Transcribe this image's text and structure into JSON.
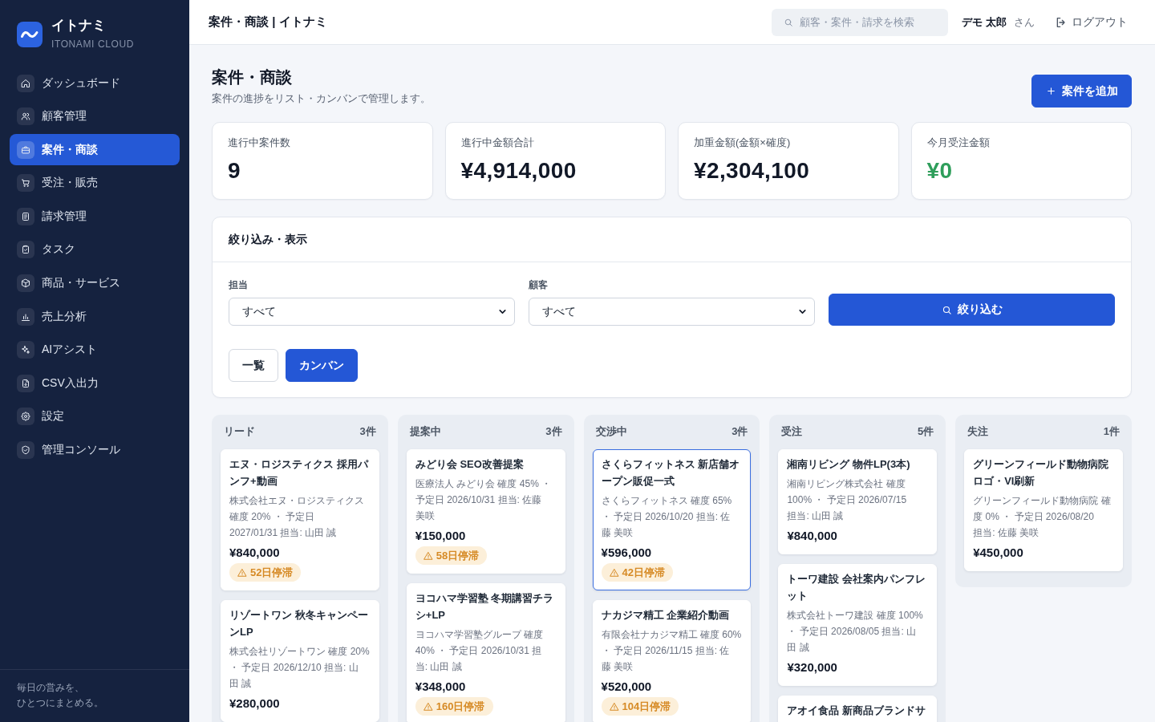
{
  "sidebar": {
    "brand": {
      "name": "イトナミ",
      "tagline": "ITONAMI CLOUD"
    },
    "items": [
      {
        "label": "ダッシュボード",
        "selected": false
      },
      {
        "label": "顧客管理",
        "selected": false
      },
      {
        "label": "案件・商談",
        "selected": true
      },
      {
        "label": "受注・販売",
        "selected": false
      },
      {
        "label": "請求管理",
        "selected": false
      },
      {
        "label": "タスク",
        "selected": false
      },
      {
        "label": "商品・サービス",
        "selected": false
      },
      {
        "label": "売上分析",
        "selected": false
      },
      {
        "label": "AIアシスト",
        "selected": false
      },
      {
        "label": "CSV入出力",
        "selected": false
      },
      {
        "label": "設定",
        "selected": false
      },
      {
        "label": "管理コンソール",
        "selected": false
      }
    ],
    "footer": [
      "毎日の営みを、",
      "ひとつにまとめる。"
    ]
  },
  "header": {
    "title": "案件・商談 | イトナミ",
    "search": {
      "placeholder": "顧客・案件・請求を検索"
    },
    "user": {
      "name": "デモ 太郎",
      "suffix": "さん"
    },
    "logout": "ログアウト"
  },
  "page": {
    "title": "案件・商談",
    "subtitle": "案件の進捗をリスト・カンバンで管理します。",
    "add_button": "案件を追加"
  },
  "stats": [
    {
      "label": "進行中案件数",
      "value": "9",
      "positive": false
    },
    {
      "label": "進行中金額合計",
      "value": "¥4,914,000",
      "positive": false
    },
    {
      "label": "加重金額(金額×確度)",
      "value": "¥2,304,100",
      "positive": false
    },
    {
      "label": "今月受注金額",
      "value": "¥0",
      "positive": true
    }
  ],
  "filters": {
    "title": "絞り込み・表示",
    "fields": [
      {
        "label": "担当",
        "value": "すべて"
      },
      {
        "label": "顧客",
        "value": "すべて"
      }
    ],
    "apply_button": "絞り込む",
    "views": [
      {
        "label": "一覧",
        "selected": false
      },
      {
        "label": "カンバン",
        "selected": true
      }
    ]
  },
  "kanban": {
    "columns": [
      {
        "title": "リード",
        "count": "3件",
        "cards": [
          {
            "title": [
              "エヌ・ロジスティクス 採用パ",
              "ンフ+動画"
            ],
            "meta": [
              "株式会社エヌ・ロジスティクス",
              "確度 20% ・ 予定日",
              "2027/01/31 担当: 山田 誠"
            ],
            "amount": "¥840,000",
            "stalled": "52日停滞",
            "selected": false
          },
          {
            "title": [
              "リゾートワン 秋冬キャンペー",
              "ンLP"
            ],
            "meta": [
              "株式会社リゾートワン 確度 20%",
              "・ 予定日 2026/12/10 担当: 山",
              "田 誠"
            ],
            "amount": "¥280,000",
            "selected": false
          }
        ]
      },
      {
        "title": "提案中",
        "count": "3件",
        "cards": [
          {
            "title": [
              "みどり会 SEO改善提案"
            ],
            "meta": [
              "医療法人 みどり会 確度 45% ・",
              "予定日 2026/10/31 担当: 佐藤",
              "美咲"
            ],
            "amount": "¥150,000",
            "stalled": "58日停滞",
            "selected": false
          },
          {
            "title": [
              "ヨコハマ学習塾 冬期講習チラ",
              "シ+LP"
            ],
            "meta": [
              "ヨコハマ学習塾グループ 確度",
              "40% ・ 予定日 2026/10/31 担",
              "当: 山田 誠"
            ],
            "amount": "¥348,000",
            "stalled": "160日停滞",
            "selected": false
          }
        ]
      },
      {
        "title": "交渉中",
        "count": "3件",
        "cards": [
          {
            "title": [
              "さくらフィットネス 新店舗オ",
              "ープン販促一式"
            ],
            "meta": [
              "さくらフィットネス 確度 65%",
              "・ 予定日 2026/10/20 担当: 佐",
              "藤 美咲"
            ],
            "amount": "¥596,000",
            "stalled": "42日停滞",
            "selected": true
          },
          {
            "title": [
              "ナカジマ精工 企業紹介動画"
            ],
            "meta": [
              "有限会社ナカジマ精工 確度 60%",
              "・ 予定日 2026/11/15 担当: 佐",
              "藤 美咲"
            ],
            "amount": "¥520,000",
            "stalled": "104日停滞",
            "selected": false
          }
        ]
      },
      {
        "title": "受注",
        "count": "5件",
        "cards": [
          {
            "title": [
              "湘南リビング 物件LP(3本)"
            ],
            "meta": [
              "湘南リビング株式会社 確度",
              "100% ・ 予定日 2026/07/15",
              "担当: 山田 誠"
            ],
            "amount": "¥840,000",
            "selected": false
          },
          {
            "title": [
              "トーワ建設 会社案内パンフレ",
              "ット"
            ],
            "meta": [
              "株式会社トーワ建設 確度 100%",
              "・ 予定日 2026/08/05 担当: 山",
              "田 誠"
            ],
            "amount": "¥320,000",
            "selected": false
          },
          {
            "title": [
              "アオイ食品 新商品ブランドサ"
            ],
            "selected": false
          }
        ]
      },
      {
        "title": "失注",
        "count": "1件",
        "cards": [
          {
            "title": [
              "グリーンフィールド動物病院",
              "ロゴ・VI刷新"
            ],
            "meta": [
              "グリーンフィールド動物病院 確",
              "度 0% ・ 予定日 2026/08/20",
              "担当: 佐藤 美咲"
            ],
            "amount": "¥450,000",
            "selected": false
          }
        ]
      }
    ]
  }
}
